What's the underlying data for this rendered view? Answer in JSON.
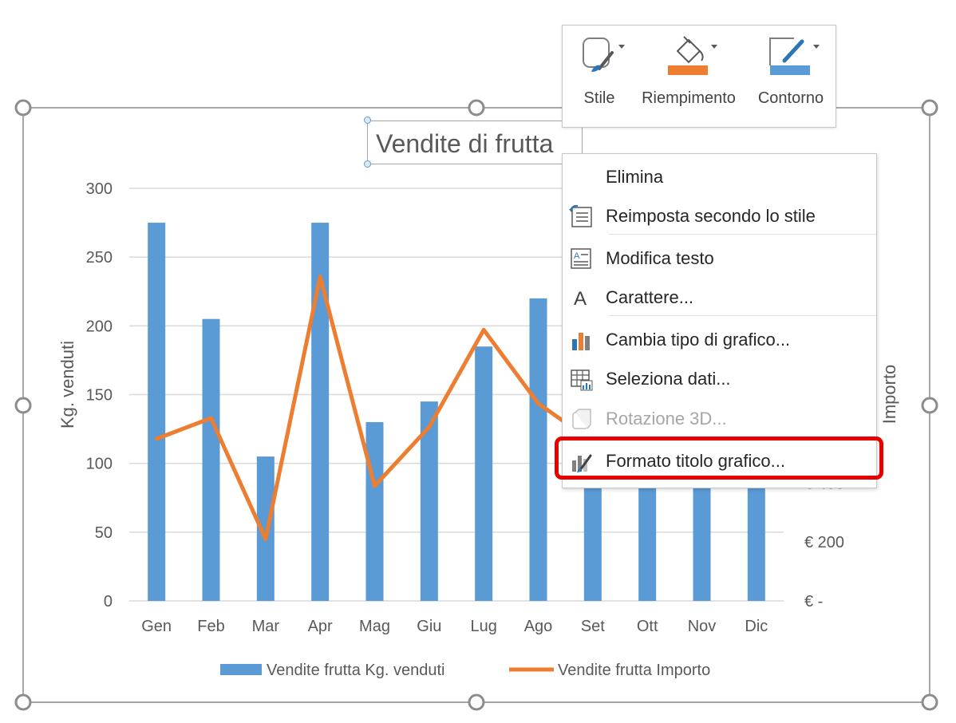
{
  "chart": {
    "title": "Vendite di frutta",
    "y_left_label": "Kg. venduti",
    "y_right_label": "Importo",
    "legend": {
      "bar": "Vendite frutta Kg. venduti",
      "line": "Vendite frutta Importo"
    }
  },
  "chart_data": {
    "type": "bar",
    "title": "Vendite di frutta",
    "categories": [
      "Gen",
      "Feb",
      "Mar",
      "Apr",
      "Mag",
      "Giu",
      "Lug",
      "Ago",
      "Set",
      "Ott",
      "Nov",
      "Dic"
    ],
    "series": [
      {
        "name": "Vendite frutta Kg. venduti",
        "type": "bar",
        "axis": "left",
        "color": "#5b9bd5",
        "values": [
          275,
          205,
          105,
          275,
          130,
          145,
          185,
          220,
          100,
          95,
          100,
          100
        ]
      },
      {
        "name": "Vendite frutta Importo",
        "type": "line",
        "axis": "right",
        "color": "#ed7d31",
        "values": [
          550,
          620,
          210,
          1100,
          390,
          590,
          920,
          670,
          540,
          390,
          null,
          null
        ]
      }
    ],
    "ylabel_left": "Kg. venduti",
    "ylabel_right": "Importo",
    "ylim_left": [
      0,
      300
    ],
    "ylim_right": [
      0,
      1400
    ],
    "yticks_left": [
      "0",
      "50",
      "100",
      "150",
      "200",
      "250",
      "300"
    ],
    "yticks_right": [
      {
        "value": 0,
        "label": "€ -"
      },
      {
        "value": 200,
        "label": "€ 200"
      },
      {
        "value": 400,
        "label": "€ 400"
      }
    ],
    "grid": true,
    "legend_position": "bottom"
  },
  "mini_toolbar": {
    "style_label": "Stile",
    "fill_label": "Riempimento",
    "outline_label": "Contorno"
  },
  "context_menu": {
    "items": [
      {
        "label": "Elimina",
        "icon": "none",
        "enabled": true
      },
      {
        "label": "Reimposta secondo lo stile",
        "icon": "reset-style-icon",
        "enabled": true
      },
      {
        "label": "Modifica testo",
        "icon": "edit-text-icon",
        "enabled": true
      },
      {
        "label": "Carattere...",
        "icon": "font-icon",
        "enabled": true
      },
      {
        "label": "Cambia tipo di grafico...",
        "icon": "chart-type-icon",
        "enabled": true
      },
      {
        "label": "Seleziona dati...",
        "icon": "select-data-icon",
        "enabled": true
      },
      {
        "label": "Rotazione 3D...",
        "icon": "rotation-3d-icon",
        "enabled": false
      },
      {
        "label": "Formato titolo grafico...",
        "icon": "format-title-icon",
        "enabled": true
      }
    ]
  },
  "icon_glyphs": {
    "font-icon": "A"
  },
  "colors": {
    "bar": "#5b9bd5",
    "line": "#ed7d31",
    "highlight": "#e60000",
    "gridline": "#d9d9d9",
    "axis_text": "#595959"
  }
}
